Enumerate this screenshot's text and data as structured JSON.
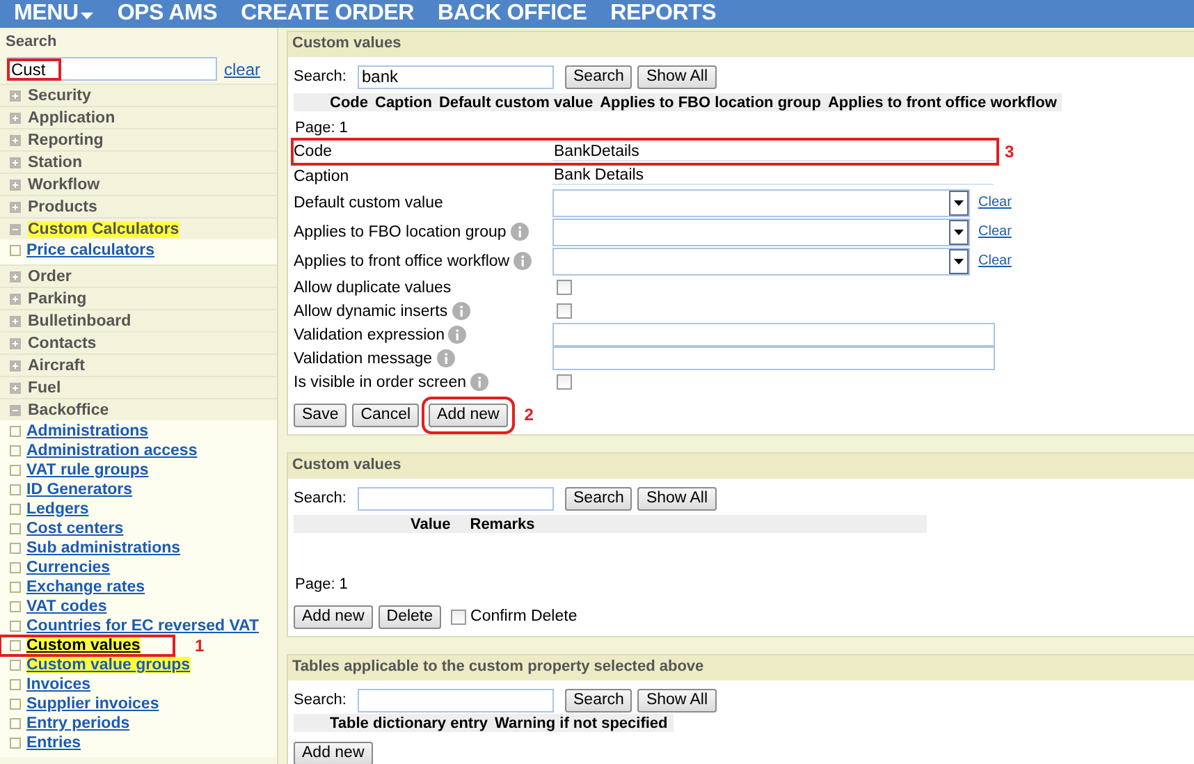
{
  "menu": [
    {
      "label": "MENU",
      "dropdown": true
    },
    {
      "label": "OPS AMS",
      "dropdown": false
    },
    {
      "label": "CREATE ORDER",
      "dropdown": false
    },
    {
      "label": "BACK OFFICE",
      "dropdown": false
    },
    {
      "label": "REPORTS",
      "dropdown": false
    }
  ],
  "sidebar": {
    "search_label": "Search",
    "search_value": "Cust",
    "search_marked": true,
    "clear": "clear",
    "groups": [
      {
        "label": "Security",
        "expanded": false,
        "highlighted": false
      },
      {
        "label": "Application",
        "expanded": false,
        "highlighted": false
      },
      {
        "label": "Reporting",
        "expanded": false,
        "highlighted": false
      },
      {
        "label": "Station",
        "expanded": false,
        "highlighted": false
      },
      {
        "label": "Workflow",
        "expanded": false,
        "highlighted": false
      },
      {
        "label": "Products",
        "expanded": false,
        "highlighted": false
      },
      {
        "label": "Custom Calculators",
        "expanded": true,
        "highlighted": true,
        "children": [
          {
            "label": "Price calculators",
            "highlighted": false,
            "selected": false
          }
        ]
      },
      {
        "label": "Order",
        "expanded": false,
        "highlighted": false
      },
      {
        "label": "Parking",
        "expanded": false,
        "highlighted": false
      },
      {
        "label": "Bulletinboard",
        "expanded": false,
        "highlighted": false
      },
      {
        "label": "Contacts",
        "expanded": false,
        "highlighted": false
      },
      {
        "label": "Aircraft",
        "expanded": false,
        "highlighted": false
      },
      {
        "label": "Fuel",
        "expanded": false,
        "highlighted": false
      },
      {
        "label": "Backoffice",
        "expanded": true,
        "highlighted": false,
        "children": [
          {
            "label": "Administrations",
            "highlighted": false,
            "selected": false
          },
          {
            "label": "Administration access",
            "highlighted": false,
            "selected": false
          },
          {
            "label": "VAT rule groups",
            "highlighted": false,
            "selected": false
          },
          {
            "label": "ID Generators",
            "highlighted": false,
            "selected": false
          },
          {
            "label": "Ledgers",
            "highlighted": false,
            "selected": false
          },
          {
            "label": "Cost centers",
            "highlighted": false,
            "selected": false
          },
          {
            "label": "Sub administrations",
            "highlighted": false,
            "selected": false
          },
          {
            "label": "Currencies",
            "highlighted": false,
            "selected": false
          },
          {
            "label": "Exchange rates",
            "highlighted": false,
            "selected": false
          },
          {
            "label": "VAT codes",
            "highlighted": false,
            "selected": false
          },
          {
            "label": "Countries for EC reversed VAT",
            "highlighted": false,
            "selected": false
          },
          {
            "label": "Custom values",
            "highlighted": true,
            "selected": true,
            "callout": "1"
          },
          {
            "label": "Custom value groups",
            "highlighted": true,
            "selected": false
          },
          {
            "label": "Invoices",
            "highlighted": false,
            "selected": false
          },
          {
            "label": "Supplier invoices",
            "highlighted": false,
            "selected": false
          },
          {
            "label": "Entry periods",
            "highlighted": false,
            "selected": false
          },
          {
            "label": "Entries",
            "highlighted": false,
            "selected": false
          }
        ]
      }
    ]
  },
  "panels": [
    {
      "title": "Custom values",
      "search_label": "Search:",
      "search_value": "bank",
      "search_button": "Search",
      "show_all_button": "Show All",
      "columns": [
        "Code",
        "Caption",
        "Default custom value",
        "Applies to FBO location group",
        "Applies to front office workflow"
      ],
      "page": "Page: 1",
      "form": [
        {
          "label": "Code",
          "kind": "text",
          "value": "BankDetails",
          "info": false,
          "callout": "3"
        },
        {
          "label": "Caption",
          "kind": "text",
          "value": "Bank Details",
          "info": false
        },
        {
          "label": "Default custom value",
          "kind": "select",
          "clear": "Clear",
          "info": false
        },
        {
          "label": "Applies to FBO location group",
          "kind": "select",
          "clear": "Clear",
          "info": true
        },
        {
          "label": "Applies to front office workflow",
          "kind": "select",
          "clear": "Clear",
          "info": true
        },
        {
          "label": "Allow duplicate values",
          "kind": "checkbox",
          "checked": false,
          "info": false
        },
        {
          "label": "Allow dynamic inserts",
          "kind": "checkbox",
          "checked": false,
          "info": true
        },
        {
          "label": "Validation expression",
          "kind": "input",
          "info": true
        },
        {
          "label": "Validation message",
          "kind": "input",
          "info": true
        },
        {
          "label": "Is visible in order screen",
          "kind": "checkbox",
          "checked": false,
          "info": true
        }
      ],
      "buttons": [
        {
          "label": "Save"
        },
        {
          "label": "Cancel"
        },
        {
          "label": "Add new",
          "callout": "2"
        }
      ]
    },
    {
      "title": "Custom values",
      "search_label": "Search:",
      "search_button": "Search",
      "show_all_button": "Show All",
      "columns": [
        "Value",
        "Remarks"
      ],
      "page": "Page: 1",
      "buttons": [
        {
          "label": "Add new"
        },
        {
          "label": "Delete"
        }
      ],
      "confirm": {
        "label": "Confirm Delete",
        "checked": false
      }
    },
    {
      "title": "Tables applicable to the custom property selected above",
      "search_label": "Search:",
      "search_button": "Search",
      "show_all_button": "Show All",
      "columns": [
        "Table dictionary entry",
        "Warning if not specified"
      ],
      "buttons": [
        {
          "label": "Add new"
        }
      ]
    }
  ]
}
